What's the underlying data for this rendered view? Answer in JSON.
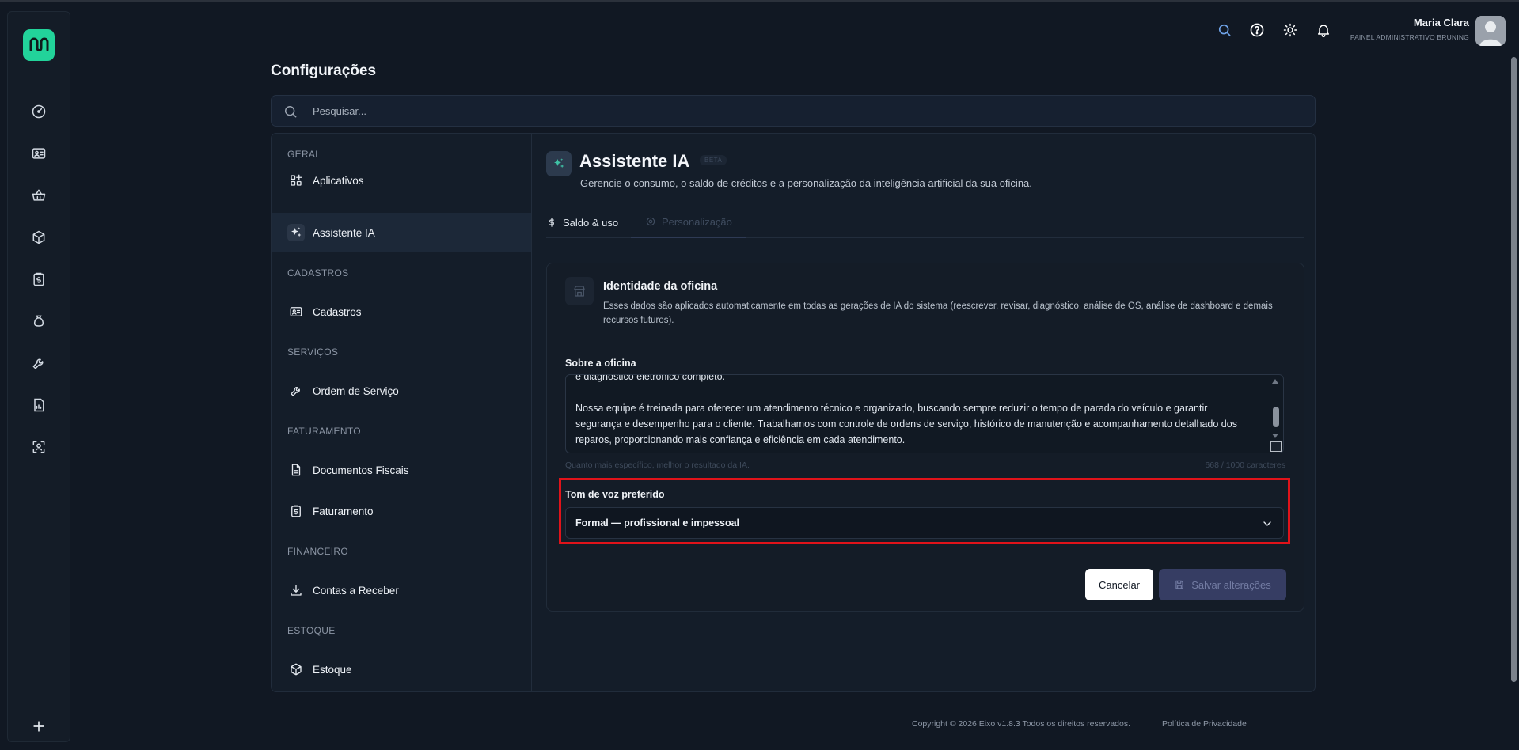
{
  "brand": {
    "accent": "#22d39a",
    "highlight": "#e0131a"
  },
  "rail": {
    "icons": [
      "dashboard-icon",
      "id-card-icon",
      "basket-icon",
      "cube-icon",
      "clipboard-dollar-icon",
      "money-bag-icon",
      "wrench-icon",
      "report-icon",
      "scan-user-icon",
      "plus-icon"
    ]
  },
  "topbar": {
    "user_name": "Maria Clara",
    "user_role": "PAINEL ADMINISTRATIVO BRUNING"
  },
  "page": {
    "title": "Configurações",
    "search_placeholder": "Pesquisar..."
  },
  "nav": {
    "sections": [
      {
        "title": "GERAL",
        "items": [
          {
            "label": "Aplicativos",
            "icon": "apps-icon"
          },
          {
            "label": "Assistente IA",
            "icon": "sparkles-icon",
            "active": true
          }
        ]
      },
      {
        "title": "CADASTROS",
        "items": [
          {
            "label": "Cadastros",
            "icon": "id-card-icon"
          }
        ]
      },
      {
        "title": "SERVIÇOS",
        "items": [
          {
            "label": "Ordem de Serviço",
            "icon": "wrench-icon"
          }
        ]
      },
      {
        "title": "FATURAMENTO",
        "items": [
          {
            "label": "Documentos Fiscais",
            "icon": "document-icon"
          },
          {
            "label": "Faturamento",
            "icon": "clipboard-dollar-icon"
          }
        ]
      },
      {
        "title": "FINANCEIRO",
        "items": [
          {
            "label": "Contas a Receber",
            "icon": "download-icon"
          }
        ]
      },
      {
        "title": "ESTOQUE",
        "items": [
          {
            "label": "Estoque",
            "icon": "cube-icon"
          }
        ]
      }
    ]
  },
  "assistant": {
    "title": "Assistente IA",
    "badge": "BETA",
    "subtitle": "Gerencie o consumo, o saldo de créditos e a personalização da inteligência artificial da sua oficina.",
    "tabs": [
      {
        "label": "Saldo & uso"
      },
      {
        "label": "Personalização",
        "active": true
      }
    ]
  },
  "identity": {
    "title": "Identidade da oficina",
    "description": "Esses dados são aplicados automaticamente em todas as gerações de IA do sistema (reescrever, revisar, diagnóstico, análise de OS, análise de dashboard e demais recursos futuros).",
    "about_label": "Sobre a oficina",
    "about_text": "e diagnóstico eletrônico completo.\n\nNossa equipe é treinada para oferecer um atendimento técnico e organizado, buscando sempre reduzir o tempo de parada do veículo e garantir segurança e desempenho para o cliente. Trabalhamos com controle de ordens de serviço, histórico de manutenção e acompanhamento detalhado dos reparos, proporcionando mais confiança e eficiência em cada atendimento.",
    "hint": "Quanto mais específico, melhor o resultado da IA.",
    "counter": "668 / 1000 caracteres",
    "tone_label": "Tom de voz preferido",
    "tone_value": "Formal — profissional e impessoal"
  },
  "actions": {
    "cancel": "Cancelar",
    "save": "Salvar alterações"
  },
  "footer": {
    "copyright": "Copyright © 2026 Eixo v1.8.3 Todos os direitos reservados.",
    "privacy": "Política de Privacidade"
  }
}
